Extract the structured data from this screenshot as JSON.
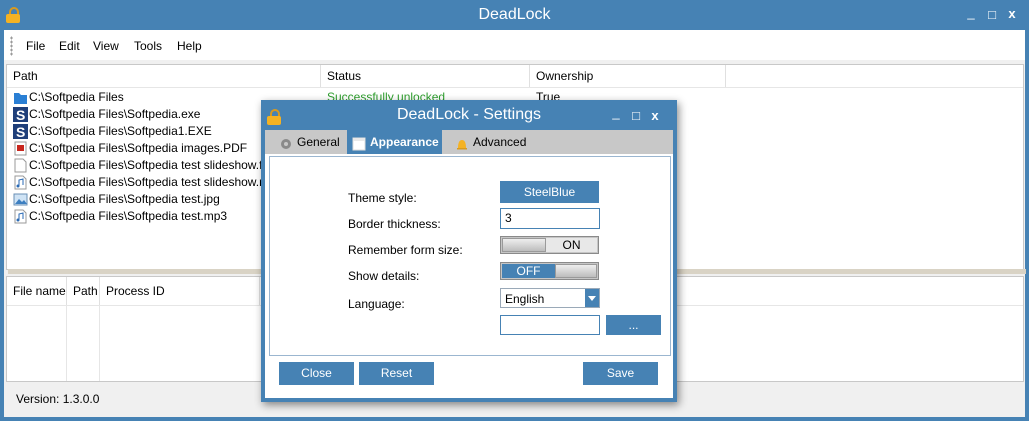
{
  "window": {
    "title": "DeadLock",
    "minimize_glyph": "_",
    "maximize_glyph": "□",
    "close_glyph": "x"
  },
  "menu": {
    "items": [
      "File",
      "Edit",
      "View",
      "Tools",
      "Help"
    ]
  },
  "file_list": {
    "columns": [
      "Path",
      "Status",
      "Ownership"
    ],
    "rows": [
      {
        "path": "C:\\Softpedia Files",
        "status": "Successfully unlocked",
        "ownership": "True",
        "icon": "folder-icon"
      },
      {
        "path": "C:\\Softpedia Files\\Softpedia.exe",
        "icon": "softpedia-s-icon"
      },
      {
        "path": "C:\\Softpedia Files\\Softpedia1.EXE",
        "icon": "softpedia-s-icon"
      },
      {
        "path": "C:\\Softpedia Files\\Softpedia images.PDF",
        "icon": "pdf-file-icon"
      },
      {
        "path": "C:\\Softpedia Files\\Softpedia test slideshow.flv",
        "icon": "blank-file-icon"
      },
      {
        "path": "C:\\Softpedia Files\\Softpedia test slideshow.mp3",
        "icon": "audio-file-icon"
      },
      {
        "path": "C:\\Softpedia Files\\Softpedia test.jpg",
        "icon": "image-file-icon"
      },
      {
        "path": "C:\\Softpedia Files\\Softpedia test.mp3",
        "icon": "audio-file-icon"
      }
    ]
  },
  "process_list": {
    "columns": [
      "File name",
      "Path",
      "Process ID"
    ]
  },
  "version_label": "Version: 1.3.0.0",
  "settings": {
    "title": "DeadLock - Settings",
    "tabs": [
      "General",
      "Appearance",
      "Advanced"
    ],
    "active_tab": "Appearance",
    "labels": {
      "theme_style": "Theme style:",
      "border_thickness": "Border thickness:",
      "remember_form_size": "Remember form size:",
      "show_details": "Show details:",
      "language": "Language:"
    },
    "values": {
      "theme_style": "SteelBlue",
      "border_thickness": "3",
      "remember_form_size": "ON",
      "show_details": "OFF",
      "language": "English",
      "extra_field": ""
    },
    "browse_label": "...",
    "buttons": {
      "close": "Close",
      "reset": "Reset",
      "save": "Save"
    }
  },
  "colors": {
    "accent": "#4682B4",
    "status_success": "#2e9e2e",
    "lock": "#f4b223"
  }
}
